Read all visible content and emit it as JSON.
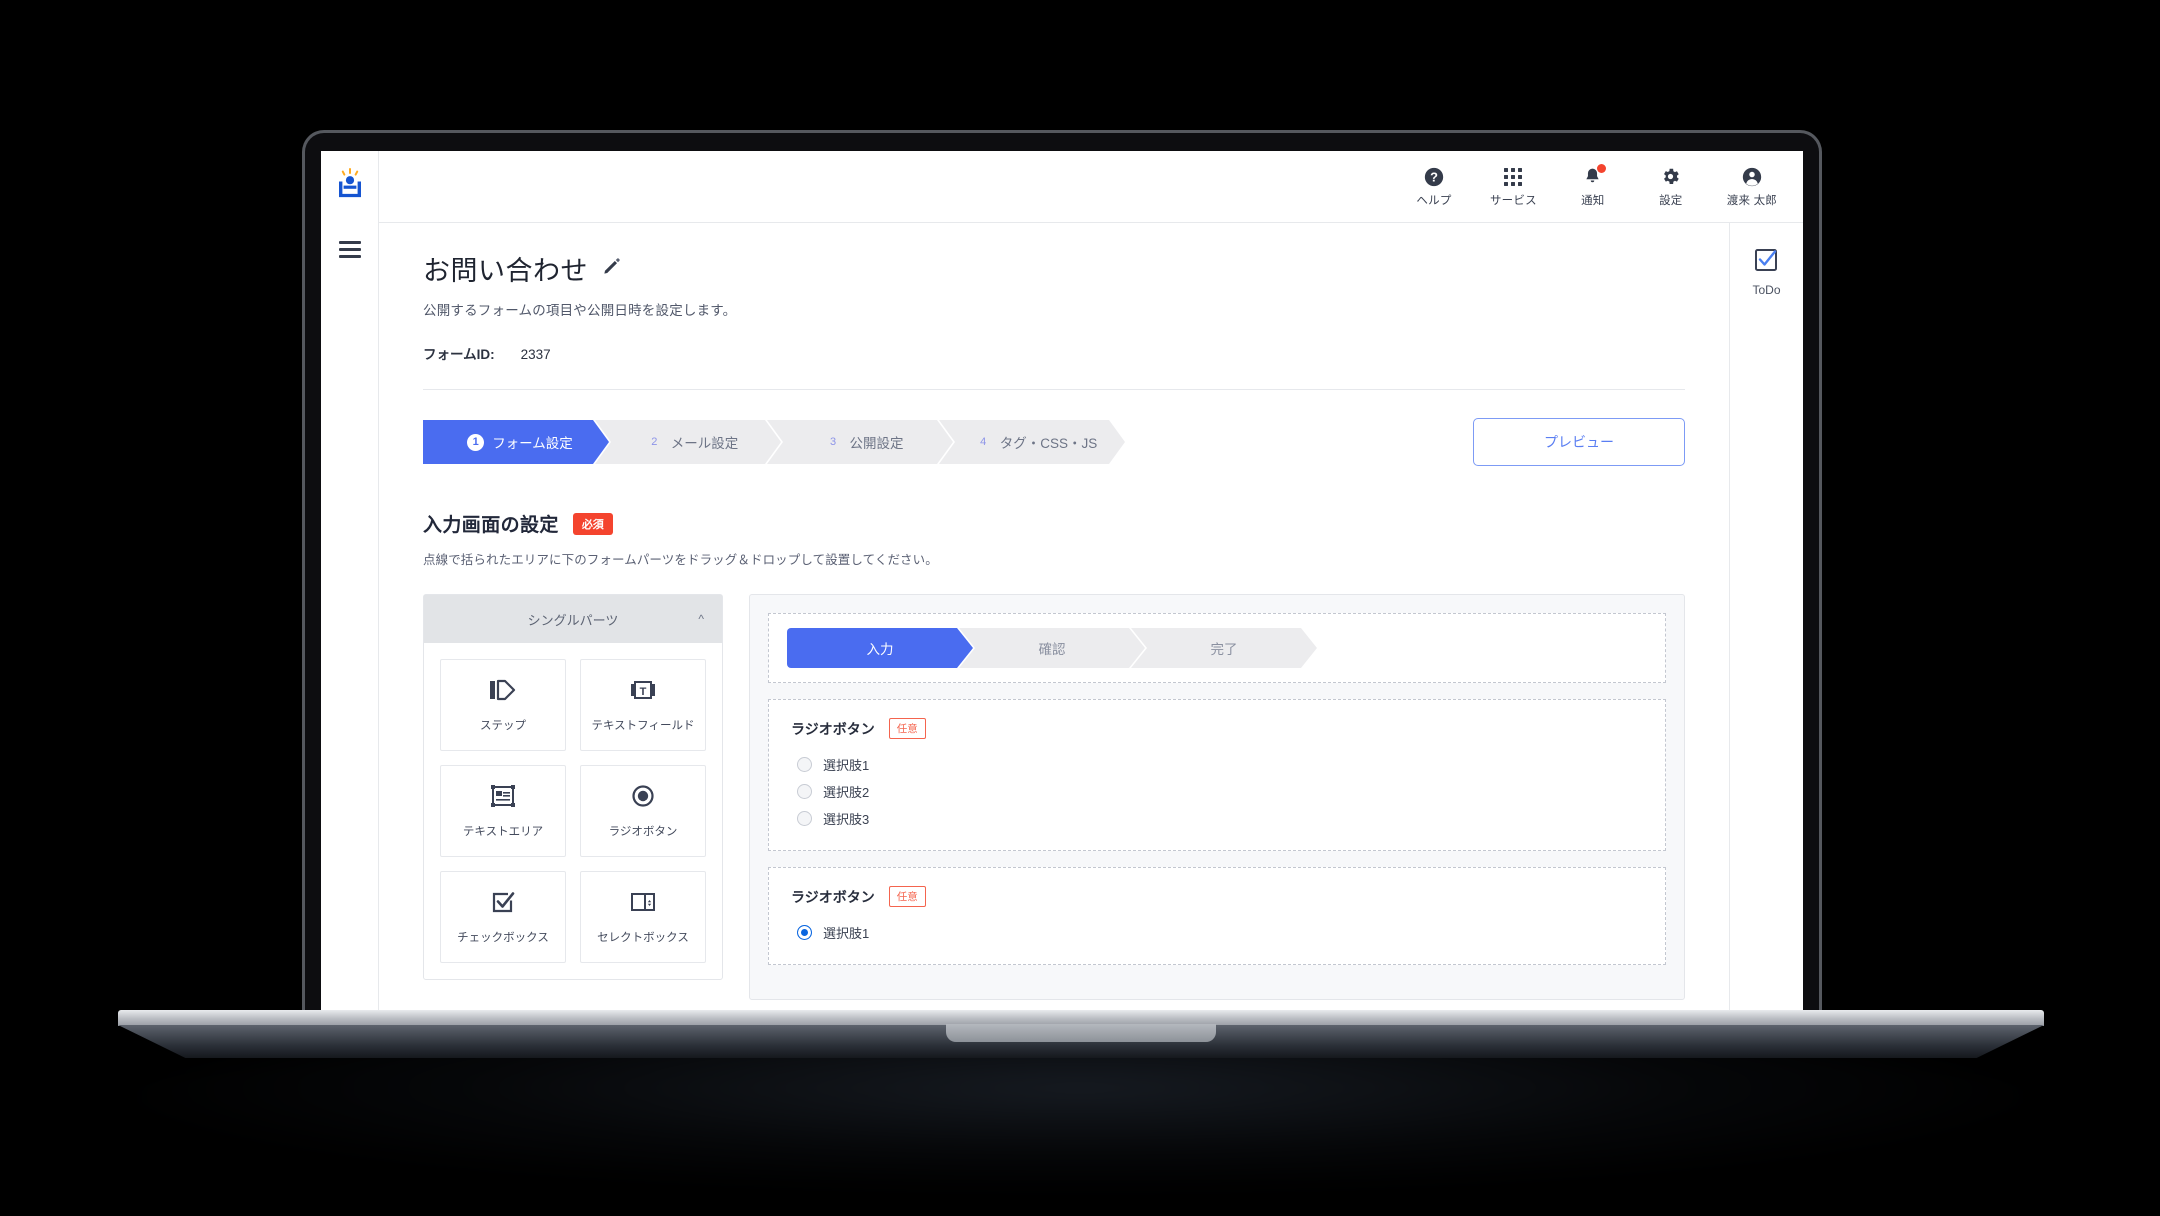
{
  "topbar": {
    "items": [
      {
        "icon": "help-icon",
        "label": "ヘルプ"
      },
      {
        "icon": "apps-grid-icon",
        "label": "サービス"
      },
      {
        "icon": "bell-icon",
        "label": "通知",
        "has_badge": true
      },
      {
        "icon": "gear-icon",
        "label": "設定"
      },
      {
        "icon": "user-avatar-icon",
        "label": "渡来 太郎"
      }
    ]
  },
  "right_rail": {
    "todo": {
      "icon": "checkbox-check-icon",
      "label": "ToDo"
    }
  },
  "page": {
    "title": "お問い合わせ",
    "edit_icon": "pencil-icon",
    "subtitle": "公開するフォームの項目や公開日時を設定します。",
    "form_id_label": "フォームID:",
    "form_id_value": "2337"
  },
  "stepper": {
    "steps": [
      {
        "num": "1",
        "label": "フォーム設定",
        "active": true
      },
      {
        "num": "2",
        "label": "メール設定",
        "active": false
      },
      {
        "num": "3",
        "label": "公開設定",
        "active": false
      },
      {
        "num": "4",
        "label": "タグ・CSS・JS",
        "active": false
      }
    ],
    "preview_button": "プレビュー"
  },
  "section": {
    "title": "入力画面の設定",
    "badge": "必須",
    "description": "点線で括られたエリアに下のフォームパーツをドラッグ＆ドロップして設置してください。"
  },
  "palette": {
    "header": "シングルパーツ",
    "collapse_icon": "chevron-up-icon",
    "parts": [
      {
        "icon": "step-icon",
        "label": "ステップ"
      },
      {
        "icon": "text-field-icon",
        "label": "テキストフィールド"
      },
      {
        "icon": "text-area-icon",
        "label": "テキストエリア"
      },
      {
        "icon": "radio-button-icon",
        "label": "ラジオボタン"
      },
      {
        "icon": "checkbox-icon",
        "label": "チェックボックス"
      },
      {
        "icon": "select-box-icon",
        "label": "セレクトボックス"
      }
    ]
  },
  "canvas": {
    "preview_steps": [
      {
        "label": "入力",
        "active": true
      },
      {
        "label": "確認",
        "active": false
      },
      {
        "label": "完了",
        "active": false
      }
    ],
    "fields": [
      {
        "label": "ラジオボタン",
        "badge": "任意",
        "options": [
          {
            "label": "選択肢1",
            "checked": false
          },
          {
            "label": "選択肢2",
            "checked": false
          },
          {
            "label": "選択肢3",
            "checked": false
          }
        ]
      },
      {
        "label": "ラジオボタン",
        "badge": "任意",
        "options": [
          {
            "label": "選択肢1",
            "checked": true
          }
        ]
      }
    ]
  },
  "colors": {
    "accent": "#4a6cf0",
    "required_badge": "#f4442e",
    "optional_badge": "#f4644e",
    "radio_checked": "#0a66e0",
    "logo_blue": "#1554d1",
    "logo_orange": "#ffab21"
  }
}
